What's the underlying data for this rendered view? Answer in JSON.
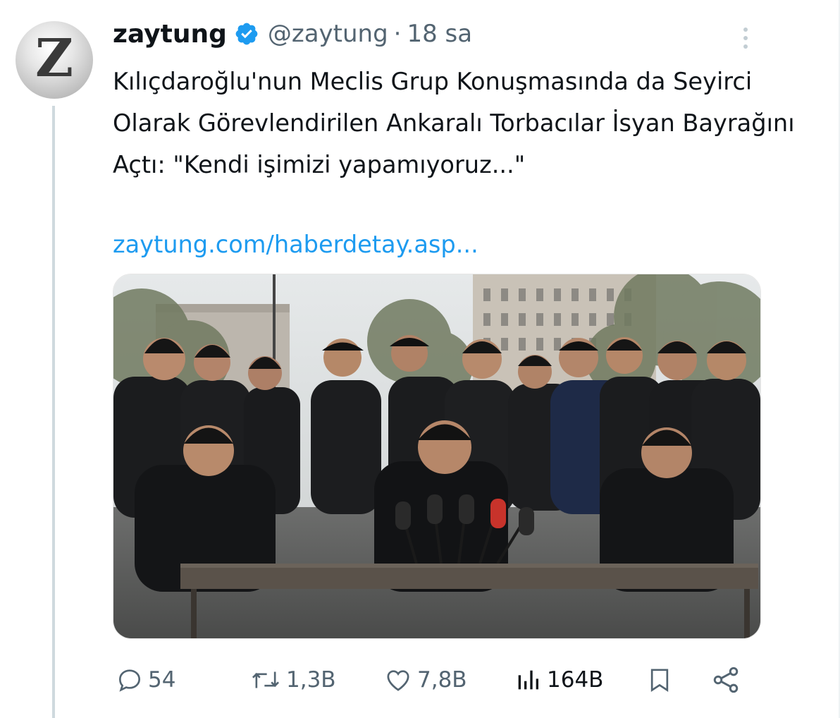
{
  "tweet": {
    "author_name": "zaytung",
    "handle": "@zaytung",
    "separator": "·",
    "time": "18 sa",
    "avatar_letter": "Z",
    "text": "Kılıçdaroğlu'nun Meclis Grup Konuşmasında da Seyirci Olarak Görevlendirilen Ankaralı Torbacılar İsyan Bayrağını Açtı: \"Kendi işimizi yapamıyoruz...\"",
    "link": "zaytung.com/haberdetay.asp...",
    "verified": true
  },
  "actions": {
    "reply": {
      "icon": "reply-icon",
      "count": "54"
    },
    "retweet": {
      "icon": "retweet-icon",
      "count": "1,3B"
    },
    "like": {
      "icon": "heart-icon",
      "count": "7,8B"
    },
    "views": {
      "icon": "views-chart-icon",
      "count": "164B"
    },
    "bookmark": {
      "icon": "bookmark-icon"
    },
    "share": {
      "icon": "share-icon"
    }
  },
  "colors": {
    "text": "#0f1419",
    "secondary": "#536471",
    "link": "#1d9bf0",
    "thread_line": "#cfd9de"
  }
}
